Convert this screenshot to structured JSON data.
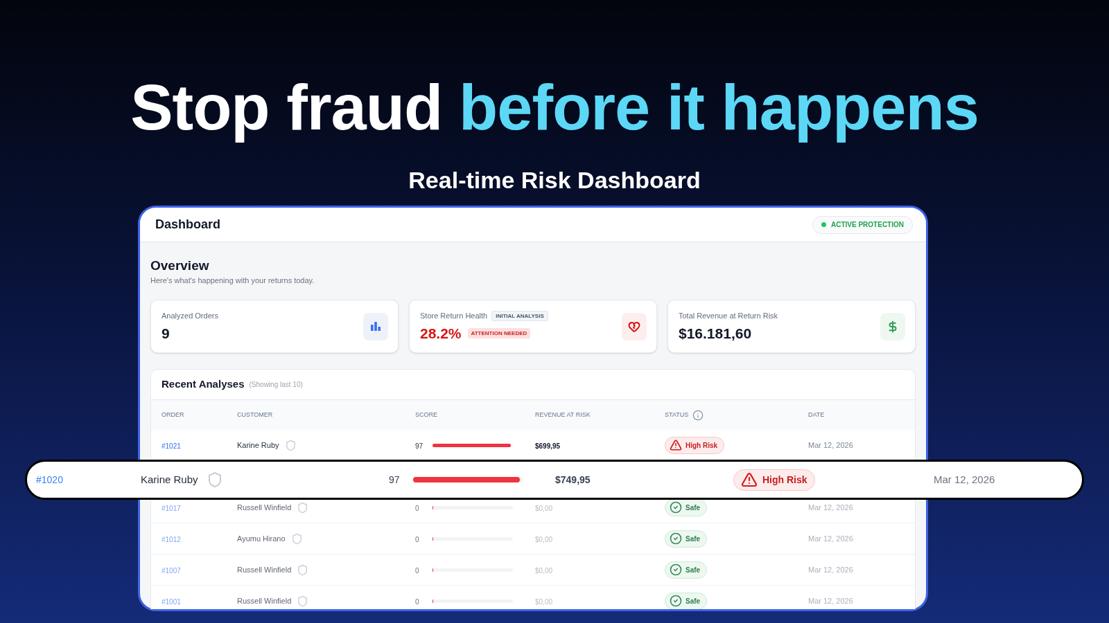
{
  "hero": {
    "headline": [
      {
        "text": "Stop fraud",
        "highlight": false
      },
      {
        "text": "before it happens",
        "highlight": true
      }
    ],
    "subtitle": "Real-time Risk Dashboard"
  },
  "dashboard": {
    "title": "Dashboard",
    "protection_status": "ACTIVE PROTECTION"
  },
  "overview": {
    "title": "Overview",
    "subtitle": "Here's what's happening with your returns today."
  },
  "stats": [
    {
      "kind": "orders",
      "label": "Analyzed Orders",
      "value": "9"
    },
    {
      "kind": "health",
      "label": "Store Return Health",
      "tag": "INITIAL ANALYSIS",
      "value": "28.2%",
      "alert": "ATTENTION NEEDED"
    },
    {
      "kind": "revenue",
      "label": "Total Revenue at Return Risk",
      "value": "$16.181,60"
    }
  ],
  "recent_analyses": {
    "title": "Recent Analyses",
    "note": "(Showing last 10)",
    "columns": [
      {
        "label": "ORDER"
      },
      {
        "label": "CUSTOMER"
      },
      {
        "label": "SCORE"
      },
      {
        "label": "REVENUE AT RISK"
      },
      {
        "label": "STATUS",
        "info": true
      },
      {
        "label": "DATE"
      }
    ],
    "rows_above": [
      {
        "order": "#1021",
        "customer": "Karine Ruby",
        "score": "97",
        "level": 0.97,
        "revenue": "$699,95",
        "status": {
          "kind": "high_risk",
          "label": "High Risk"
        },
        "date": "Mar 12, 2026"
      }
    ],
    "highlighted_row": {
      "order": "#1020",
      "customer": "Karine Ruby",
      "score": "97",
      "level": 0.97,
      "revenue": "$749,95",
      "status": {
        "kind": "high_risk",
        "label": "High Risk"
      },
      "date": "Mar 12, 2026"
    },
    "rows_below": [
      {
        "order": "#1017",
        "customer": "Russell Winfield",
        "score": "0",
        "level": 0,
        "revenue": "$0,00",
        "status": {
          "kind": "safe",
          "label": "Safe"
        },
        "date": "Mar 12, 2026"
      },
      {
        "order": "#1012",
        "customer": "Ayumu Hirano",
        "score": "0",
        "level": 0,
        "revenue": "$0,00",
        "status": {
          "kind": "safe",
          "label": "Safe"
        },
        "date": "Mar 12, 2026"
      },
      {
        "order": "#1007",
        "customer": "Russell Winfield",
        "score": "0",
        "level": 0,
        "revenue": "$0,00",
        "status": {
          "kind": "safe",
          "label": "Safe"
        },
        "date": "Mar 12, 2026"
      },
      {
        "order": "#1001",
        "customer": "Russell Winfield",
        "score": "0",
        "level": 0,
        "revenue": "$0,00",
        "status": {
          "kind": "safe",
          "label": "Safe"
        },
        "date": "Mar 12, 2026"
      }
    ]
  }
}
